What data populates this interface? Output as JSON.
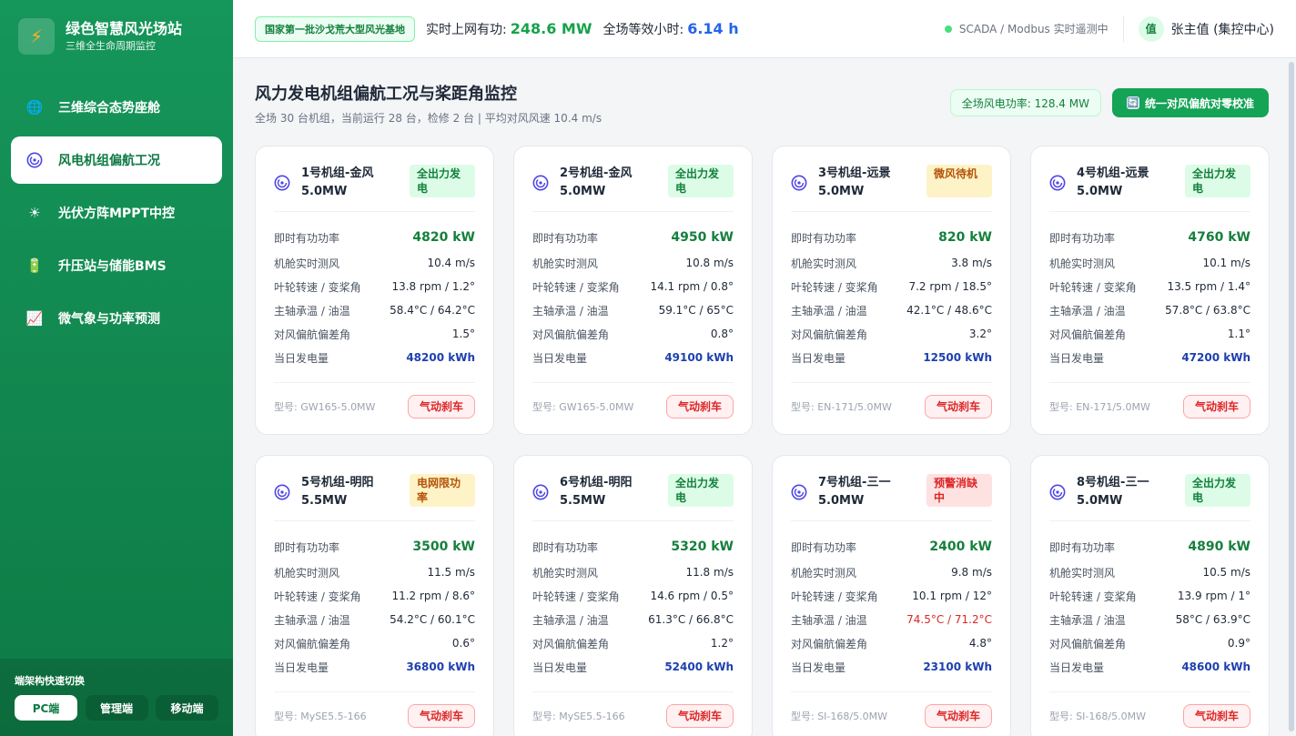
{
  "brand": {
    "title": "绿色智慧风光场站",
    "subtitle": "三维全生命周期监控",
    "logo_icon": "lightning-icon"
  },
  "sidebar": {
    "items": [
      {
        "label": "三维综合态势座舱",
        "icon": "globe-icon",
        "glyph": "🌐",
        "active": false
      },
      {
        "label": "风电机组偏航工况",
        "icon": "fan-icon",
        "glyph": "",
        "active": true
      },
      {
        "label": "光伏方阵MPPT中控",
        "icon": "sun-icon",
        "glyph": "☀",
        "active": false
      },
      {
        "label": "升压站与储能BMS",
        "icon": "battery-icon",
        "glyph": "🔋",
        "active": false
      },
      {
        "label": "微气象与功率预测",
        "icon": "chart-icon",
        "glyph": "📈",
        "active": false
      }
    ],
    "switch_title": "端架构快速切换",
    "switch_buttons": [
      "PC端",
      "管理端",
      "移动端"
    ]
  },
  "topbar": {
    "base_tag": "国家第一批沙戈荒大型风光基地",
    "metric1_label": "实时上网有功:",
    "metric1_value": "248.6 MW",
    "metric2_label": "全场等效小时:",
    "metric2_value": "6.14 h",
    "status_text": "SCADA / Modbus 实时遥测中",
    "avatar_text": "值",
    "user_name": "张主值 (集控中心)"
  },
  "page": {
    "title": "风力发电机组偏航工况与桨距角监控",
    "subtitle": "全场 30 台机组，当前运行 28 台，检修 2 台 | 平均对风风速 10.4 m/s",
    "power_pill": "全场风电功率: 128.4 MW",
    "calibrate_button": "统一对风偏航对零校准",
    "calibrate_icon": "🔄"
  },
  "row_labels": [
    "即时有功功率",
    "机舱实时测风",
    "叶轮转速 / 变桨角",
    "主轴承温 / 油温",
    "对风偏航偏差角",
    "当日发电量"
  ],
  "brake_label": "气动刹车",
  "turbines": [
    {
      "name": "1号机组-金风 5.0MW",
      "status": "全出力发电",
      "status_color": "green",
      "power": "4820 kW",
      "wind": "10.4 m/s",
      "rotor": "13.8 rpm / 1.2°",
      "temp": "58.4°C / 64.2°C",
      "temp_warn": false,
      "yaw": "1.5°",
      "energy": "48200 kWh",
      "model": "型号: GW165-5.0MW"
    },
    {
      "name": "2号机组-金风 5.0MW",
      "status": "全出力发电",
      "status_color": "green",
      "power": "4950 kW",
      "wind": "10.8 m/s",
      "rotor": "14.1 rpm / 0.8°",
      "temp": "59.1°C / 65°C",
      "temp_warn": false,
      "yaw": "0.8°",
      "energy": "49100 kWh",
      "model": "型号: GW165-5.0MW"
    },
    {
      "name": "3号机组-远景 5.0MW",
      "status": "微风待机",
      "status_color": "amber",
      "power": "820 kW",
      "wind": "3.8 m/s",
      "rotor": "7.2 rpm / 18.5°",
      "temp": "42.1°C / 48.6°C",
      "temp_warn": false,
      "yaw": "3.2°",
      "energy": "12500 kWh",
      "model": "型号: EN-171/5.0MW"
    },
    {
      "name": "4号机组-远景 5.0MW",
      "status": "全出力发电",
      "status_color": "green",
      "power": "4760 kW",
      "wind": "10.1 m/s",
      "rotor": "13.5 rpm / 1.4°",
      "temp": "57.8°C / 63.8°C",
      "temp_warn": false,
      "yaw": "1.1°",
      "energy": "47200 kWh",
      "model": "型号: EN-171/5.0MW"
    },
    {
      "name": "5号机组-明阳 5.5MW",
      "status": "电网限功率",
      "status_color": "amber",
      "power": "3500 kW",
      "wind": "11.5 m/s",
      "rotor": "11.2 rpm / 8.6°",
      "temp": "54.2°C / 60.1°C",
      "temp_warn": false,
      "yaw": "0.6°",
      "energy": "36800 kWh",
      "model": "型号: MySE5.5-166"
    },
    {
      "name": "6号机组-明阳 5.5MW",
      "status": "全出力发电",
      "status_color": "green",
      "power": "5320 kW",
      "wind": "11.8 m/s",
      "rotor": "14.6 rpm / 0.5°",
      "temp": "61.3°C / 66.8°C",
      "temp_warn": false,
      "yaw": "1.2°",
      "energy": "52400 kWh",
      "model": "型号: MySE5.5-166"
    },
    {
      "name": "7号机组-三一 5.0MW",
      "status": "预警消缺中",
      "status_color": "red",
      "power": "2400 kW",
      "wind": "9.8 m/s",
      "rotor": "10.1 rpm / 12°",
      "temp": "74.5°C / 71.2°C",
      "temp_warn": true,
      "yaw": "4.8°",
      "energy": "23100 kWh",
      "model": "型号: SI-168/5.0MW"
    },
    {
      "name": "8号机组-三一 5.0MW",
      "status": "全出力发电",
      "status_color": "green",
      "power": "4890 kW",
      "wind": "10.5 m/s",
      "rotor": "13.9 rpm / 1°",
      "temp": "58°C / 63.9°C",
      "temp_warn": false,
      "yaw": "0.9°",
      "energy": "48600 kWh",
      "model": "型号: SI-168/5.0MW"
    }
  ]
}
